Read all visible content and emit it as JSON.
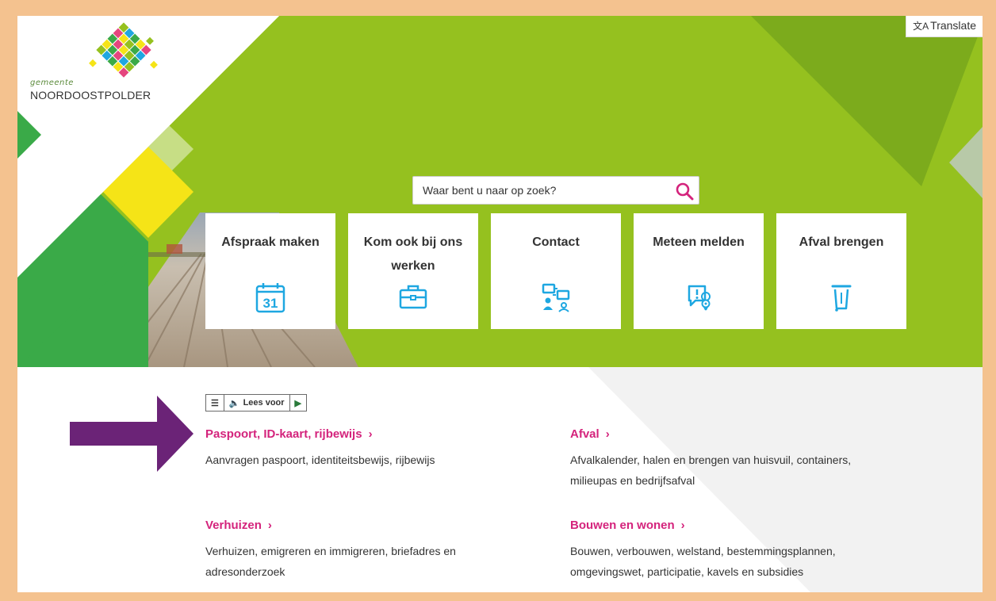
{
  "header": {
    "logo_sub": "gemeente",
    "logo_name": "NOORDOOSTPOLDER",
    "translate_label": "Translate",
    "translate_icon": "translate-icon"
  },
  "search": {
    "placeholder": "Waar bent u naar op zoek?",
    "icon": "search-icon"
  },
  "tiles": [
    {
      "label": "Afspraak maken",
      "icon": "calendar-icon"
    },
    {
      "label": "Kom ook bij ons werken",
      "icon": "briefcase-icon"
    },
    {
      "label": "Contact",
      "icon": "contact-icon"
    },
    {
      "label": "Meteen melden",
      "icon": "report-location-icon"
    },
    {
      "label": "Afval brengen",
      "icon": "trash-bin-icon"
    }
  ],
  "calendar_day": "31",
  "readspeaker": {
    "label": "Lees voor"
  },
  "sections": [
    {
      "title": "Paspoort, ID-kaart, rijbewijs",
      "desc": "Aanvragen paspoort, identiteitsbewijs, rijbewijs"
    },
    {
      "title": "Afval",
      "desc": "Afvalkalender, halen en brengen van huisvuil, containers, milieupas en bedrijfsafval"
    },
    {
      "title": "Verhuizen",
      "desc": "Verhuizen, emigreren en immigreren, briefadres en adresonderzoek"
    },
    {
      "title": "Bouwen en wonen",
      "desc": "Bouwen, verbouwen, welstand, bestemmingsplannen, omgevingswet, participatie, kavels en subsidies"
    }
  ],
  "chevron": "›",
  "colors": {
    "accent_green": "#95c11f",
    "dark_green": "#3aaa48",
    "yellow": "#f5e417",
    "link_magenta": "#d4237c",
    "icon_blue": "#1ea7e1",
    "arrow_purple": "#6b2377",
    "frame_orange": "#f4c28f"
  }
}
